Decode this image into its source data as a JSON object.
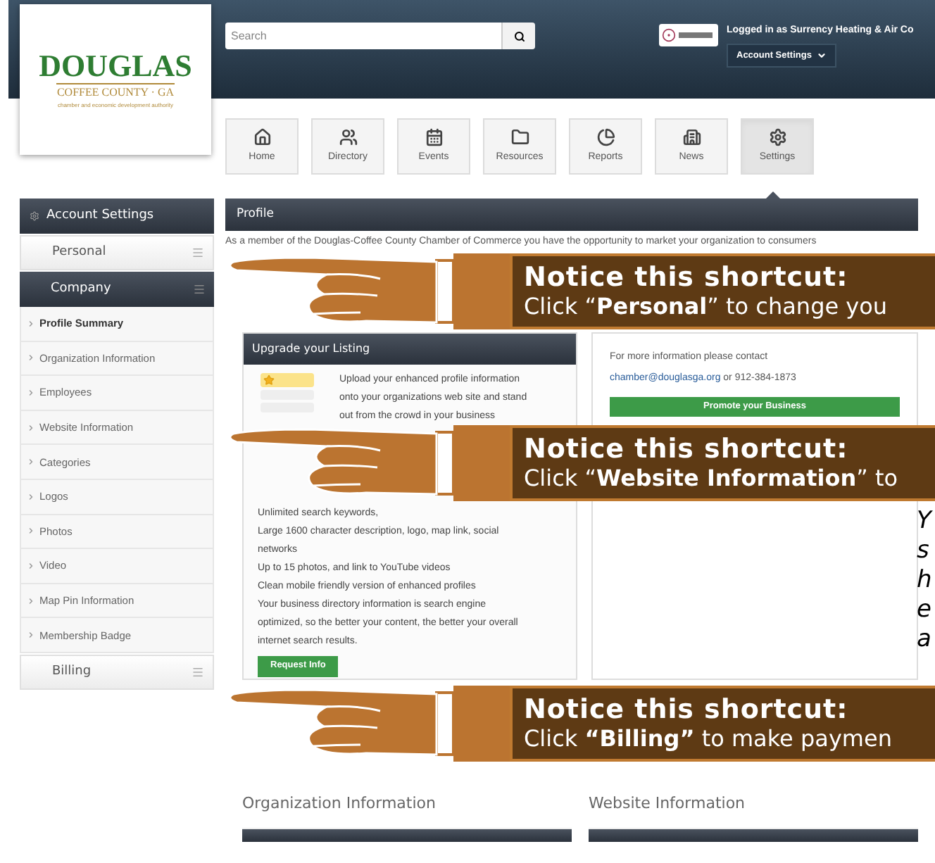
{
  "header": {
    "logo": {
      "name": "DOUGLAS",
      "region": "COFFEE COUNTY · GA",
      "tagline": "chamber and economic development authority"
    },
    "search": {
      "placeholder": "Search"
    },
    "user": {
      "logged_in": "Logged in as Surrency Heating & Air Co",
      "menu": "Account Settings"
    }
  },
  "nav": [
    {
      "label": "Home",
      "selected": false
    },
    {
      "label": "Directory",
      "selected": false
    },
    {
      "label": "Events",
      "selected": false
    },
    {
      "label": "Resources",
      "selected": false
    },
    {
      "label": "Reports",
      "selected": false
    },
    {
      "label": "News",
      "selected": false
    },
    {
      "label": "Settings",
      "selected": true
    }
  ],
  "sidebar": {
    "title": "Account Settings",
    "sections": [
      {
        "label": "Personal",
        "expanded": false
      },
      {
        "label": "Company",
        "expanded": true,
        "children": [
          {
            "label": "Profile Summary",
            "selected": true
          },
          {
            "label": "Organization Information",
            "selected": false
          },
          {
            "label": "Employees",
            "selected": false
          },
          {
            "label": "Website Information",
            "selected": false
          },
          {
            "label": "Categories",
            "selected": false
          },
          {
            "label": "Logos",
            "selected": false
          },
          {
            "label": "Photos",
            "selected": false
          },
          {
            "label": "Video",
            "selected": false
          },
          {
            "label": "Map Pin Information",
            "selected": false
          },
          {
            "label": "Membership Badge",
            "selected": false
          }
        ]
      },
      {
        "label": "Billing",
        "expanded": false
      }
    ]
  },
  "profile": {
    "title": "Profile",
    "intro": "As a member of the Douglas-Coffee County Chamber of Commerce you have the opportunity to market your organization to consumers"
  },
  "upgrade_card": {
    "title": "Upgrade your Listing",
    "lines_top": [
      "Upload your enhanced profile information",
      "onto your organizations web site and stand",
      "out from the crowd in your business"
    ],
    "lines_bottom": [
      "Unlimited search keywords,",
      "Large 1600 character description, logo, map link, social",
      "networks",
      "Up to 15 photos, and link to YouTube videos",
      "Clean mobile friendly version of enhanced profiles",
      "Your business directory information is search engine",
      "optimized, so the better your content, the better your overall",
      "internet search results."
    ],
    "button": "Request Info"
  },
  "contact_card": {
    "text": "For more information please contact",
    "email": "chamber@douglasga.org",
    "phone": " or 912-384-1873",
    "button": "Promote your Business"
  },
  "sections": [
    {
      "title": "Organization Information",
      "level": 1
    },
    {
      "title": "Website Information",
      "level": 1
    }
  ],
  "callouts": [
    {
      "heading": "Notice this shortcut:",
      "text": "Click “**Personal**” to change you"
    },
    {
      "heading": "Notice this shortcut:",
      "text": "Click “**Website Information**” to"
    },
    {
      "heading": "Notice this shortcut:",
      "text": "Click **“Billing”** to make paymen"
    }
  ],
  "side_note_fragment": [
    "Y",
    "s",
    "h",
    "e",
    "a"
  ]
}
